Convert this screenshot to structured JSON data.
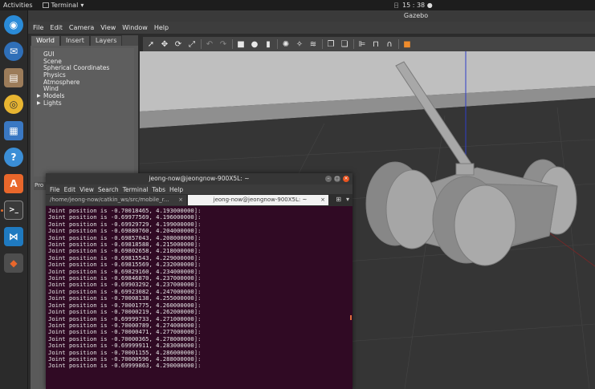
{
  "topbar": {
    "activities": "Activities",
    "app_name": "Terminal",
    "clock": "15 : 38",
    "indicator": "日"
  },
  "gazebo": {
    "window_title": "Gazebo",
    "menu": [
      "File",
      "Edit",
      "Camera",
      "View",
      "Window",
      "Help"
    ],
    "tabs": [
      "World",
      "Insert",
      "Layers"
    ],
    "tree": [
      {
        "label": "GUI",
        "expandable": false
      },
      {
        "label": "Scene",
        "expandable": false
      },
      {
        "label": "Spherical Coordinates",
        "expandable": false
      },
      {
        "label": "Physics",
        "expandable": false
      },
      {
        "label": "Atmosphere",
        "expandable": false
      },
      {
        "label": "Wind",
        "expandable": false
      },
      {
        "label": "Models",
        "expandable": true
      },
      {
        "label": "Lights",
        "expandable": true
      }
    ],
    "properties_label": "Pro",
    "toolbar_icons": [
      "select-arrow-icon",
      "translate-icon",
      "rotate-icon",
      "scale-icon",
      "undo-icon",
      "redo-icon",
      "box-icon",
      "sphere-icon",
      "cylinder-icon",
      "point-light-icon",
      "spot-light-icon",
      "directional-light-icon",
      "copy-icon",
      "paste-icon",
      "align-icon",
      "snap-icon",
      "magnet-icon",
      "camera-view-icon"
    ],
    "colors": {
      "sky": "#bdbdbd",
      "ground": "#343434",
      "model": "#9a9a9a"
    }
  },
  "terminal": {
    "title": "jeong-now@jeongnow-900X5L: ~",
    "menu": [
      "File",
      "Edit",
      "View",
      "Search",
      "Terminal",
      "Tabs",
      "Help"
    ],
    "tabs": [
      {
        "label": "/home/jeong-now/catkin_ws/src/mobile_r...",
        "active": false
      },
      {
        "label": "jeong-now@jeongnow-900X5L: ~",
        "active": true
      }
    ],
    "lines": [
      "Joint position is -0.70018465, 4.193000000]:",
      "Joint position is -0.69977569, 4.196000000]:",
      "Joint position is -0.69929729, 4.199000000]:",
      "Joint position is -0.69880760, 4.204000000]:",
      "Joint position is -0.69857043, 4.208000000]:",
      "Joint position is -0.69818588, 4.215000000]:",
      "Joint position is -0.69802658, 4.218000000]:",
      "Joint position is -0.69815543, 4.229000000]:",
      "Joint position is -0.69815569, 4.232000000]:",
      "Joint position is -0.69829160, 4.234000000]:",
      "Joint position is -0.69846870, 4.237000000]:",
      "Joint position is -0.69903292, 4.237000000]:",
      "Joint position is -0.69923082, 4.247000000]:",
      "Joint position is -0.70008138, 4.255000000]:",
      "Joint position is -0.70001775, 4.260000000]:",
      "Joint position is -0.70000219, 4.262000000]:",
      "Joint position is -0.69999733, 4.271000000]:",
      "Joint position is -0.70000789, 4.274000000]:",
      "Joint position is -0.70000471, 4.277000000]:",
      "Joint position is -0.70000365, 4.278000000]:",
      "Joint position is -0.69999911, 4.283000000]:",
      "Joint position is -0.70001155, 4.286000000]:",
      "Joint position is -0.70000596, 4.288000000]:",
      "Joint position is -0.69999863, 4.290000000]:"
    ]
  },
  "dock": [
    {
      "name": "chrome-icon",
      "color": "#2a8bd8"
    },
    {
      "name": "thunderbird-icon",
      "color": "#2f6fb8"
    },
    {
      "name": "files-icon",
      "color": "#9c7c5a"
    },
    {
      "name": "rhythmbox-icon",
      "color": "#e8b531"
    },
    {
      "name": "libreoffice-writer-icon",
      "color": "#3a78c3"
    },
    {
      "name": "help-icon",
      "color": "#3b8ed6"
    },
    {
      "name": "software-center-icon",
      "color": "#e9672b"
    },
    {
      "name": "terminal-icon",
      "color": "#3a3a3a"
    },
    {
      "name": "vscode-icon",
      "color": "#1f7ac0"
    },
    {
      "name": "ros-sublime-icon",
      "color": "#4e4e4e"
    }
  ]
}
